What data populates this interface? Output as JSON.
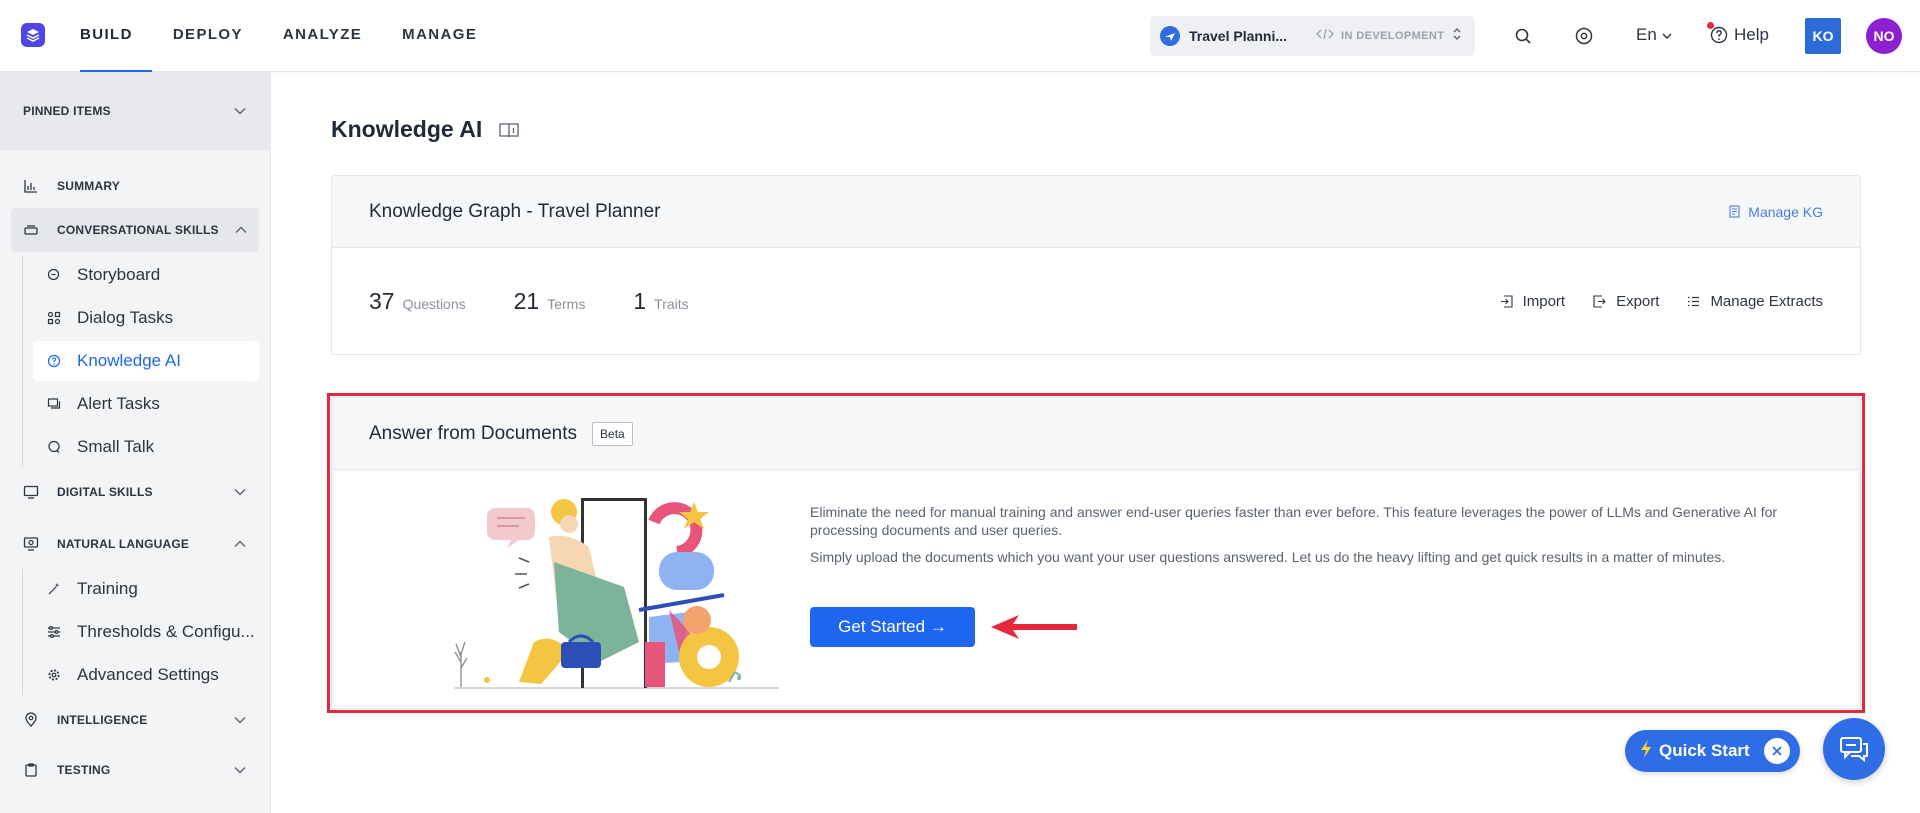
{
  "topnav": {
    "items": [
      "BUILD",
      "DEPLOY",
      "ANALYZE",
      "MANAGE"
    ],
    "active": "BUILD"
  },
  "app_switcher": {
    "name": "Travel Planni...",
    "status": "IN DEVELOPMENT"
  },
  "toolbar": {
    "language": "En",
    "help_label": "Help",
    "user_initials_1": "KO",
    "user_initials_2": "NO"
  },
  "sidebar": {
    "pinned_label": "PINNED ITEMS",
    "summary_label": "SUMMARY",
    "conversational": {
      "label": "CONVERSATIONAL SKILLS",
      "items": [
        "Storyboard",
        "Dialog Tasks",
        "Knowledge AI",
        "Alert Tasks",
        "Small Talk"
      ],
      "active": "Knowledge AI"
    },
    "digital_skills_label": "DIGITAL SKILLS",
    "natural_language": {
      "label": "NATURAL LANGUAGE",
      "items": [
        "Training",
        "Thresholds & Configu...",
        "Advanced Settings"
      ]
    },
    "intelligence_label": "INTELLIGENCE",
    "testing_label": "TESTING"
  },
  "page": {
    "title": "Knowledge AI"
  },
  "kg_card": {
    "title": "Knowledge Graph - Travel Planner",
    "manage_label": "Manage KG",
    "stats": [
      {
        "value": "37",
        "label": "Questions"
      },
      {
        "value": "21",
        "label": "Terms"
      },
      {
        "value": "1",
        "label": "Traits"
      }
    ],
    "actions": {
      "import": "Import",
      "export": "Export",
      "manage_extracts": "Manage Extracts"
    }
  },
  "afd_card": {
    "title": "Answer from Documents",
    "badge": "Beta",
    "paragraph_1": "Eliminate the need for manual training and answer end-user queries faster than ever before. This feature leverages the power of LLMs and Generative AI for processing documents and user queries.",
    "paragraph_2": "Simply upload the documents which you want your user questions answered. Let us do the heavy lifting and get quick results in a matter of minutes.",
    "button_label": "Get Started →"
  },
  "quick_start": {
    "label": "Quick Start"
  },
  "colors": {
    "accent": "#1c66f2",
    "highlight": "#e5283b",
    "brand": "#4f46e5"
  }
}
